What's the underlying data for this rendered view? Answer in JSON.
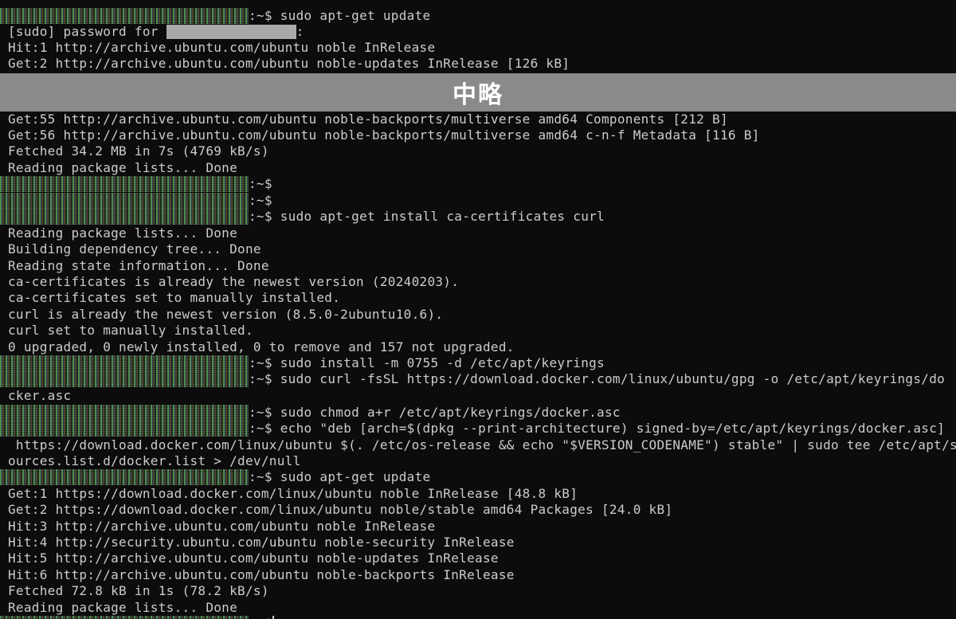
{
  "terminal": {
    "background": "#0c0c0c",
    "foreground": "#cccccc",
    "lines": [
      {
        "kind": "prompt",
        "prompt_suffix": ":~$",
        "command": " sudo apt-get update"
      },
      {
        "kind": "sudo",
        "text": "[sudo] password for ",
        "after": ":"
      },
      {
        "kind": "output",
        "text": "Hit:1 http://archive.ubuntu.com/ubuntu noble InRelease"
      },
      {
        "kind": "output",
        "text": "Get:2 http://archive.ubuntu.com/ubuntu noble-updates InRelease [126 kB]"
      },
      {
        "kind": "output",
        "text": "Get:55 http://archive.ubuntu.com/ubuntu noble-backports/multiverse amd64 Components [212 B]"
      },
      {
        "kind": "output",
        "text": "Get:56 http://archive.ubuntu.com/ubuntu noble-backports/multiverse amd64 c-n-f Metadata [116 B]"
      },
      {
        "kind": "output",
        "text": "Fetched 34.2 MB in 7s (4769 kB/s)"
      },
      {
        "kind": "output",
        "text": "Reading package lists... Done"
      },
      {
        "kind": "prompt",
        "prompt_suffix": ":~$",
        "command": ""
      },
      {
        "kind": "prompt",
        "prompt_suffix": ":~$",
        "command": ""
      },
      {
        "kind": "prompt",
        "prompt_suffix": ":~$",
        "command": " sudo apt-get install ca-certificates curl"
      },
      {
        "kind": "output",
        "text": "Reading package lists... Done"
      },
      {
        "kind": "output",
        "text": "Building dependency tree... Done"
      },
      {
        "kind": "output",
        "text": "Reading state information... Done"
      },
      {
        "kind": "output",
        "text": "ca-certificates is already the newest version (20240203)."
      },
      {
        "kind": "output",
        "text": "ca-certificates set to manually installed."
      },
      {
        "kind": "output",
        "text": "curl is already the newest version (8.5.0-2ubuntu10.6)."
      },
      {
        "kind": "output",
        "text": "curl set to manually installed."
      },
      {
        "kind": "output",
        "text": "0 upgraded, 0 newly installed, 0 to remove and 157 not upgraded."
      },
      {
        "kind": "prompt",
        "prompt_suffix": ":~$",
        "command": " sudo install -m 0755 -d /etc/apt/keyrings"
      },
      {
        "kind": "prompt",
        "prompt_suffix": ":~$",
        "command": " sudo curl -fsSL https://download.docker.com/linux/ubuntu/gpg -o /etc/apt/keyrings/do"
      },
      {
        "kind": "output",
        "text": "cker.asc"
      },
      {
        "kind": "prompt",
        "prompt_suffix": ":~$",
        "command": " sudo chmod a+r /etc/apt/keyrings/docker.asc"
      },
      {
        "kind": "prompt",
        "prompt_suffix": ":~$",
        "command": " echo \"deb [arch=$(dpkg --print-architecture) signed-by=/etc/apt/keyrings/docker.asc]"
      },
      {
        "kind": "output",
        "text": " https://download.docker.com/linux/ubuntu $(. /etc/os-release && echo \"$VERSION_CODENAME\") stable\" | sudo tee /etc/apt/s"
      },
      {
        "kind": "output",
        "text": "ources.list.d/docker.list > /dev/null"
      },
      {
        "kind": "prompt",
        "prompt_suffix": ":~$",
        "command": " sudo apt-get update"
      },
      {
        "kind": "output",
        "text": "Get:1 https://download.docker.com/linux/ubuntu noble InRelease [48.8 kB]"
      },
      {
        "kind": "output",
        "text": "Get:2 https://download.docker.com/linux/ubuntu noble/stable amd64 Packages [24.0 kB]"
      },
      {
        "kind": "output",
        "text": "Hit:3 http://archive.ubuntu.com/ubuntu noble InRelease"
      },
      {
        "kind": "output",
        "text": "Hit:4 http://security.ubuntu.com/ubuntu noble-security InRelease"
      },
      {
        "kind": "output",
        "text": "Hit:5 http://archive.ubuntu.com/ubuntu noble-updates InRelease"
      },
      {
        "kind": "output",
        "text": "Hit:6 http://archive.ubuntu.com/ubuntu noble-backports InRelease"
      },
      {
        "kind": "output",
        "text": "Fetched 72.8 kB in 1s (78.2 kB/s)"
      },
      {
        "kind": "output",
        "text": "Reading package lists... Done"
      },
      {
        "kind": "prompt",
        "prompt_suffix": ":~$",
        "command": ""
      }
    ]
  },
  "omission_banner": {
    "label": "中略",
    "background": "#8a8a8a"
  }
}
